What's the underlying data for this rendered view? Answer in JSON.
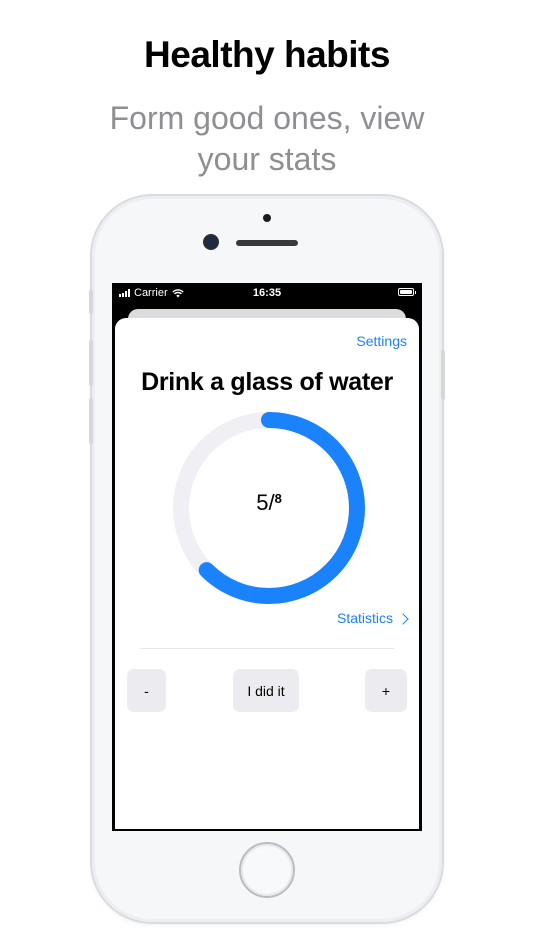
{
  "promo": {
    "headline": "Healthy habits",
    "subline": "Form good ones, view your stats"
  },
  "statusbar": {
    "carrier": "Carrier",
    "time": "16:35"
  },
  "habit": {
    "settings_label": "Settings",
    "title": "Drink a glass of water",
    "done": "5",
    "separator": "/",
    "goal": "8",
    "progress_fraction": 0.625,
    "statistics_label": "Statistics",
    "buttons": {
      "minus": "-",
      "did_it": "I did it",
      "plus": "+"
    }
  },
  "colors": {
    "accent": "#1a82fb",
    "ring_track": "#efeff4",
    "button_bg": "#ececf0"
  }
}
